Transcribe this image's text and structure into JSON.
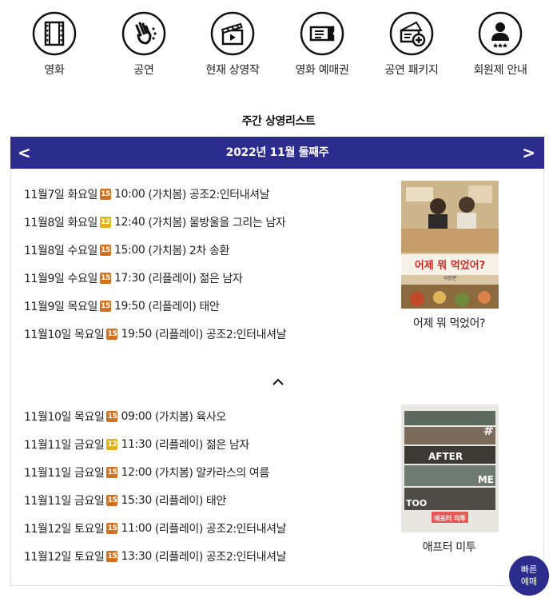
{
  "nav": {
    "items": [
      {
        "label": "영화",
        "icon": "film-icon"
      },
      {
        "label": "공연",
        "icon": "performance-hand-icon"
      },
      {
        "label": "현재 상영작",
        "icon": "clapperboard-icon"
      },
      {
        "label": "영화 예매권",
        "icon": "ticket-icon"
      },
      {
        "label": "공연 패키지",
        "icon": "package-ticket-icon"
      },
      {
        "label": "회원제 안내",
        "icon": "member-icon"
      }
    ]
  },
  "schedule": {
    "title": "주간 상영리스트",
    "week_label": "2022년 11월 둘째주",
    "prev_label": "<",
    "next_label": ">",
    "groups": [
      {
        "rows": [
          {
            "date": "11월7일 화요일",
            "rating": "15",
            "time": "10:00",
            "type": "(가치봄)",
            "movie": "공조2:인터내셔날"
          },
          {
            "date": "11월8일 화요일",
            "rating": "12",
            "time": "12:40",
            "type": "(가치봄)",
            "movie": "물방울을 그리는 남자"
          },
          {
            "date": "11월8일 수요일",
            "rating": "15",
            "time": "15:00",
            "type": "(가치봄)",
            "movie": "2차 송환"
          },
          {
            "date": "11월9일 수요일",
            "rating": "15",
            "time": "17:30",
            "type": "(리플레이)",
            "movie": "젊은 남자"
          },
          {
            "date": "11월9일 목요일",
            "rating": "15",
            "time": "19:50",
            "type": "(리플레이)",
            "movie": "태안"
          },
          {
            "date": "11월10일 목요일",
            "rating": "15",
            "time": "19:50",
            "type": "(리플레이)",
            "movie": "공조2:인터내셔날"
          }
        ],
        "poster_caption": "어제 뭐 먹었어?",
        "poster_text": "어제 뭐 먹었어?",
        "poster_subtext": "극장판"
      },
      {
        "rows": [
          {
            "date": "11월10일 목요일",
            "rating": "15",
            "time": "09:00",
            "type": "(가치봄)",
            "movie": "육사오"
          },
          {
            "date": "11월11일 금요일",
            "rating": "12",
            "time": "11:30",
            "type": "(리플레이)",
            "movie": "젊은 남자"
          },
          {
            "date": "11월11일 금요일",
            "rating": "15",
            "time": "12:00",
            "type": "(가치봄)",
            "movie": "알카라스의 여름"
          },
          {
            "date": "11월11일 금요일",
            "rating": "15",
            "time": "15:30",
            "type": "(리플레이)",
            "movie": "태안"
          },
          {
            "date": "11월12일 토요일",
            "rating": "15",
            "time": "11:00",
            "type": "(리플레이)",
            "movie": "공조2:인터내셔날"
          },
          {
            "date": "11월12일 토요일",
            "rating": "15",
            "time": "13:30",
            "type": "(리플레이)",
            "movie": "공조2:인터내셔날"
          }
        ],
        "poster_caption": "애프터 미투",
        "poster_text_1": "AFTER",
        "poster_text_2": "ME",
        "poster_text_3": "TOO",
        "poster_hash": "#",
        "poster_title_kr": "애프터 미투"
      }
    ]
  },
  "quick_booking": {
    "line1": "빠른",
    "line2": "예매"
  },
  "colors": {
    "accent": "#2b2c8c",
    "rating_15": "#d4711f",
    "rating_12": "#e0b31c"
  }
}
